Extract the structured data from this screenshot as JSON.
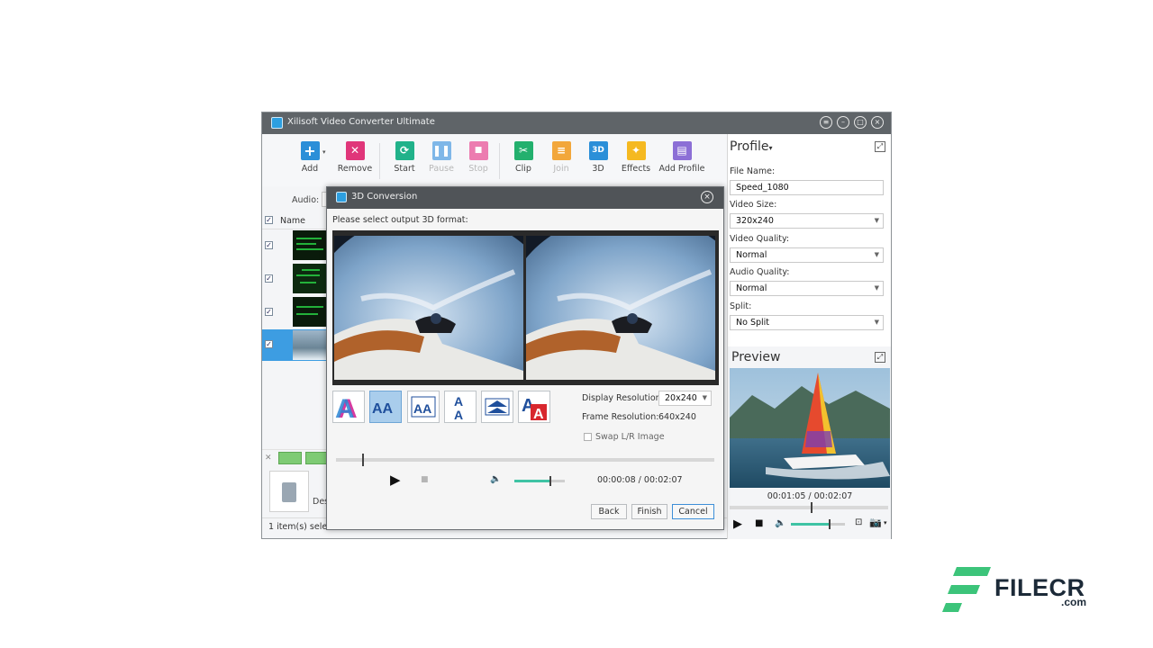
{
  "app": {
    "title": "Xilisoft Video Converter Ultimate"
  },
  "toolbar": {
    "add": "Add",
    "remove": "Remove",
    "start": "Start",
    "pause": "Pause",
    "stop": "Stop",
    "clip": "Clip",
    "join": "Join",
    "three_d": "3D",
    "three_d_icon": "3D",
    "effects": "Effects",
    "add_profile": "Add Profile"
  },
  "list": {
    "audio_label": "Audio:",
    "name_header": "Name",
    "footer_status": "1 item(s) selecte",
    "device_label": "Des"
  },
  "profile": {
    "title": "Profile",
    "file_name_label": "File Name:",
    "file_name_value": "Speed_1080",
    "video_size_label": "Video Size:",
    "video_size_value": "320x240",
    "video_quality_label": "Video Quality:",
    "video_quality_value": "Normal",
    "audio_quality_label": "Audio Quality:",
    "audio_quality_value": "Normal",
    "split_label": "Split:",
    "split_value": "No Split"
  },
  "preview": {
    "title": "Preview",
    "time": "00:01:05 / 00:02:07",
    "progress": 0.51,
    "volume": 0.7
  },
  "dialog": {
    "title": "3D Conversion",
    "prompt": "Please select output 3D format:",
    "display_resolution_label": "Display Resolution:",
    "display_resolution_value": "20x240",
    "frame_resolution_label": "Frame Resolution:",
    "frame_resolution_value": "640x240",
    "swap_label": "Swap L/R Image",
    "time": "00:00:08 / 00:02:07",
    "progress": 0.07,
    "volume": 0.7,
    "back": "Back",
    "finish": "Finish",
    "cancel": "Cancel",
    "mode_glyph": "A",
    "mode_glyph_pair": "AA"
  },
  "watermark": {
    "brand": "FILECR",
    "suffix": ".com"
  },
  "colors": {
    "accent": "#2d9fe0",
    "titlebar": "#5f6468",
    "dialog_title": "#505458",
    "selection": "#a9cdec",
    "watermark_green": "#3cc47a"
  }
}
